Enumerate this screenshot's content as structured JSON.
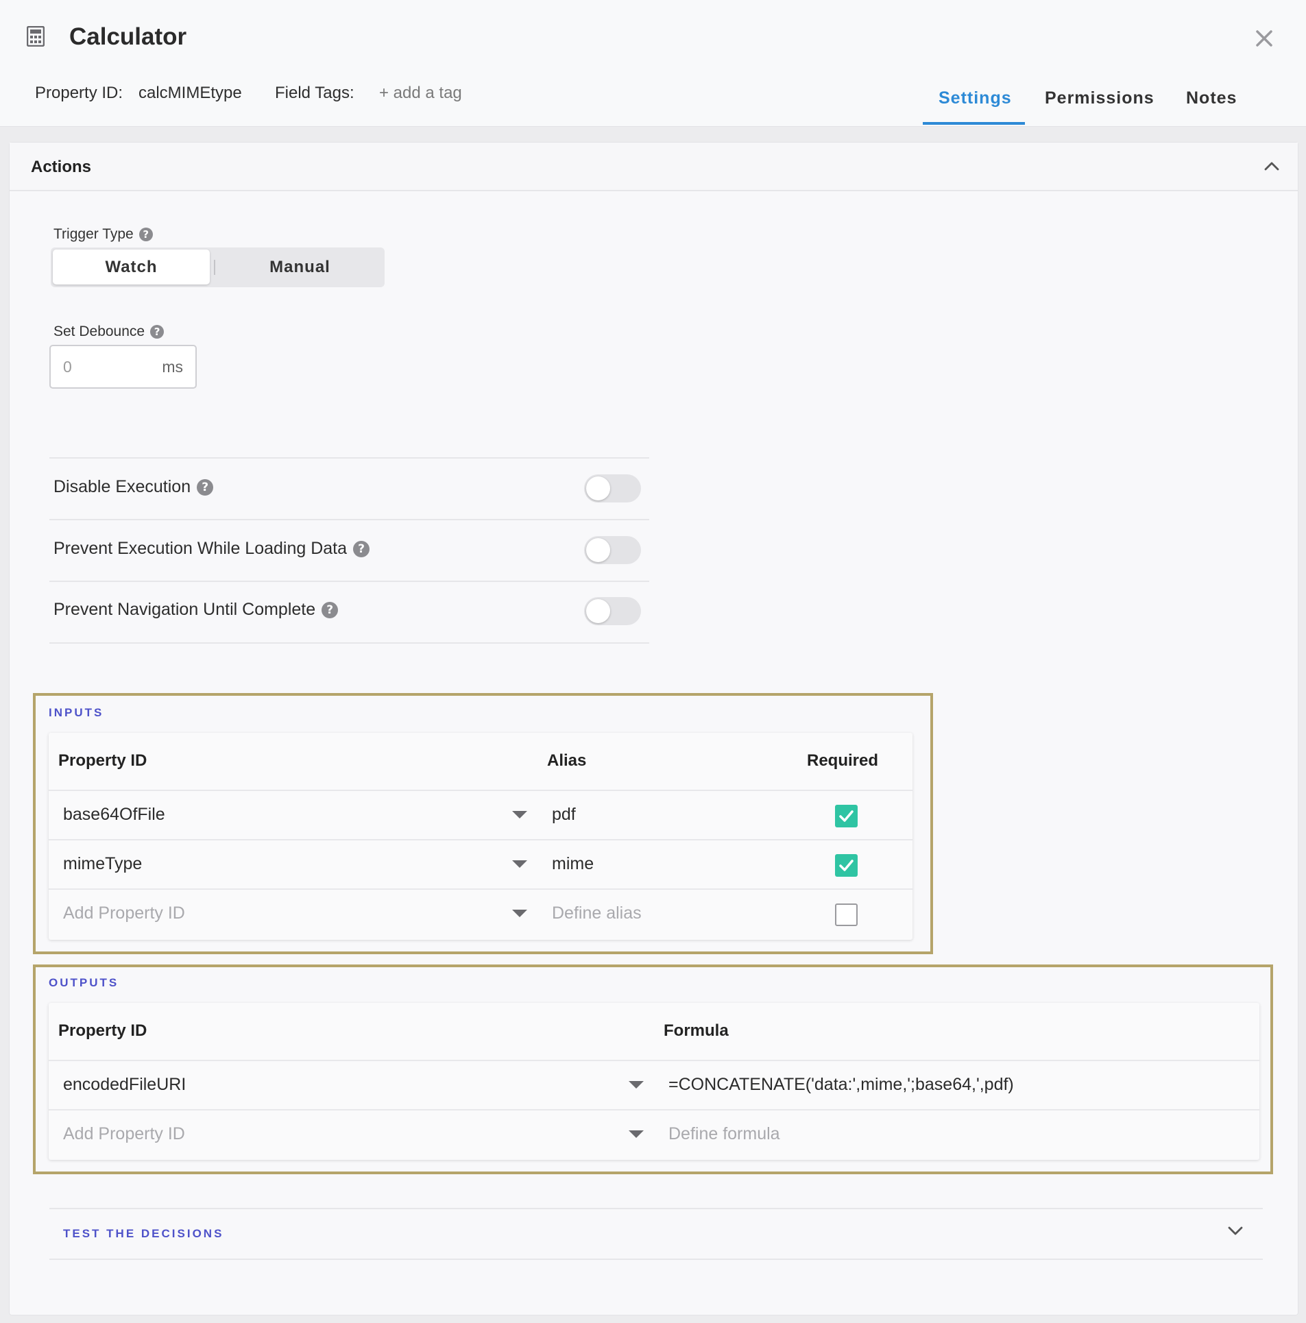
{
  "header": {
    "title": "Calculator",
    "property_id_label": "Property ID:",
    "property_id_value": "calcMIMEtype",
    "field_tags_label": "Field Tags:",
    "add_tag": "+ add a tag",
    "tabs": [
      {
        "label": "Settings",
        "active": true
      },
      {
        "label": "Permissions",
        "active": false
      },
      {
        "label": "Notes",
        "active": false
      }
    ]
  },
  "actions": {
    "title": "Actions",
    "trigger_type": {
      "label": "Trigger Type",
      "options": [
        "Watch",
        "Manual"
      ],
      "selected": "Watch"
    },
    "debounce": {
      "label": "Set Debounce",
      "value": "0",
      "unit": "ms"
    },
    "toggles": [
      {
        "label": "Disable Execution",
        "on": false
      },
      {
        "label": "Prevent Execution While Loading Data",
        "on": false
      },
      {
        "label": "Prevent Navigation Until Complete",
        "on": false
      }
    ]
  },
  "inputs": {
    "title": "INPUTS",
    "columns": [
      "Property ID",
      "Alias",
      "Required"
    ],
    "rows": [
      {
        "property_id": "base64OfFile",
        "alias": "pdf",
        "required": true
      },
      {
        "property_id": "mimeType",
        "alias": "mime",
        "required": true
      }
    ],
    "new_row": {
      "property_placeholder": "Add Property ID",
      "alias_placeholder": "Define alias",
      "required": false
    }
  },
  "outputs": {
    "title": "OUTPUTS",
    "columns": [
      "Property ID",
      "Formula"
    ],
    "rows": [
      {
        "property_id": "encodedFileURI",
        "formula": "=CONCATENATE('data:',mime,';base64,',pdf)"
      }
    ],
    "new_row": {
      "property_placeholder": "Add Property ID",
      "formula_placeholder": "Define formula"
    }
  },
  "test_section": {
    "title": "TEST THE DECISIONS"
  },
  "colors": {
    "accent_blue": "#2d8ad6",
    "section_indigo": "#4e52c9",
    "check_green": "#2fc4a3",
    "highlight_gold": "#b5a46a"
  },
  "icons": [
    "calculator-icon",
    "close-icon",
    "chevron-up-icon",
    "help-icon",
    "dropdown-caret-icon",
    "checkmark-icon",
    "chevron-down-icon"
  ]
}
